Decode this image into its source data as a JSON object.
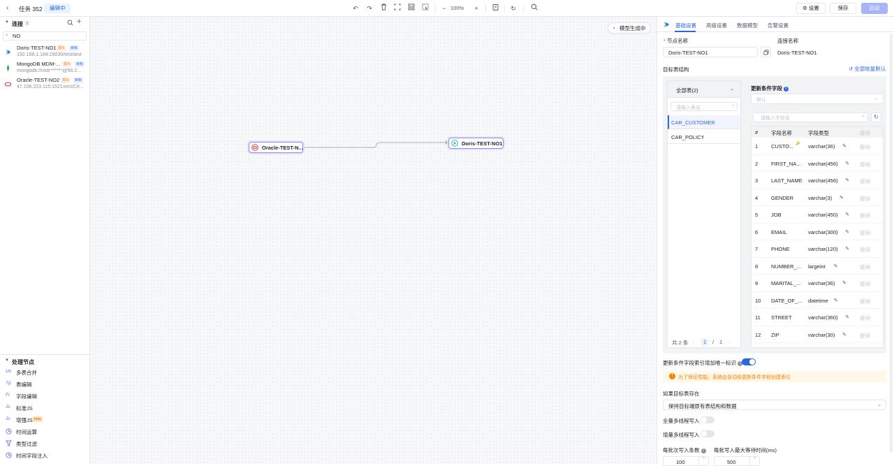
{
  "header": {
    "task_title": "任务 352",
    "edit_badge": "编辑中",
    "zoom": "100%",
    "settings_label": "设置",
    "save_label": "保存",
    "start_label": "启动"
  },
  "connections": {
    "title": "连接",
    "count": "3",
    "search_value": "NO",
    "items": [
      {
        "name": "Doris-TEST-NO1",
        "tag_source": "源头",
        "tag_target": "目标",
        "address": "192.168.1.184:29030/test/test"
      },
      {
        "name": "MongoDB MDM-...",
        "tag_source": "源头",
        "tag_target": "目标",
        "address": "mongodb://root:******@58.2..."
      },
      {
        "name": "Oracle-TEST-NO2",
        "tag_source": "源头",
        "tag_target": "目标",
        "address": "47.106.223.115:1521/orcl/C#..."
      }
    ]
  },
  "processing": {
    "title": "处理节点",
    "items": [
      {
        "icon": "Un",
        "label": "多表合并"
      },
      {
        "icon": "Tp",
        "label": "表编辑"
      },
      {
        "icon": "Fr",
        "label": "字段编辑"
      },
      {
        "icon": "Js",
        "label": "标准JS"
      },
      {
        "icon": "Js",
        "label": "增强JS",
        "badge": "beta"
      },
      {
        "icon": "clock",
        "label": "时间运算"
      },
      {
        "icon": "filter",
        "label": "类型过滤"
      },
      {
        "icon": "clock",
        "label": "时间字段注入"
      }
    ]
  },
  "canvas": {
    "model_status": "模型生成中",
    "source_node": "Oracle-TEST-N...",
    "target_node": "Doris-TEST-NO1"
  },
  "panel": {
    "tabs": [
      "基础设置",
      "高级设置",
      "数据模型",
      "告警设置"
    ],
    "node_name_label": "节点名称",
    "node_name_value": "Doris-TEST-NO1",
    "conn_name_label": "连接名称",
    "conn_name_value": "Doris-TEST-NO1",
    "target_struct_label": "目标表结构",
    "restore_label": "全部恢复默认",
    "all_tables": "全部表(2)",
    "table_search_ph": "请输入表名",
    "tables": [
      "CAR_CUSTOMER",
      "CAR_POLICY"
    ],
    "pager_total": "共 2 条",
    "pager_current": "1",
    "pager_sep": "/",
    "pager_pages": "1",
    "update_field_label": "更新条件字段",
    "update_field_ph": "默认",
    "field_search_ph": "请输入字段名",
    "field_headers": [
      "#",
      "字段名称",
      "字段类型",
      "撤销"
    ],
    "fields": [
      {
        "n": "1",
        "name": "CUSTO...",
        "type": "varchar(36)",
        "key": true
      },
      {
        "n": "2",
        "name": "FIRST_NA...",
        "type": "varchar(456)"
      },
      {
        "n": "3",
        "name": "LAST_NAME",
        "type": "varchar(456)"
      },
      {
        "n": "4",
        "name": "GENDER",
        "type": "varchar(3)"
      },
      {
        "n": "5",
        "name": "JOB",
        "type": "varchar(450)"
      },
      {
        "n": "6",
        "name": "EMAIL",
        "type": "varchar(300)"
      },
      {
        "n": "7",
        "name": "PHONE",
        "type": "varchar(120)"
      },
      {
        "n": "8",
        "name": "NUMBER_...",
        "type": "largeint"
      },
      {
        "n": "9",
        "name": "MARITAL_...",
        "type": "varchar(36)"
      },
      {
        "n": "10",
        "name": "DATE_OF_...",
        "type": "datetime"
      },
      {
        "n": "11",
        "name": "STREET",
        "type": "varchar(360)"
      },
      {
        "n": "12",
        "name": "ZIP",
        "type": "varchar(30)"
      }
    ],
    "revoke_label": "撤销",
    "unique_index_label": "更新条件字段索引增加唯一标识",
    "warn_text": "为了保证性能，系统会自动给更新条件字段创建索引",
    "if_exists_label": "如果目标表存在",
    "if_exists_value": "保持目标端原有表结构和数据",
    "full_multi_label": "全量多线程写入",
    "incr_multi_label": "增量多线程写入",
    "batch_count_label": "每批次写入条数",
    "batch_wait_label": "每批写入最大等待时间(ms)",
    "batch_count_value": "100",
    "batch_wait_value": "500"
  }
}
